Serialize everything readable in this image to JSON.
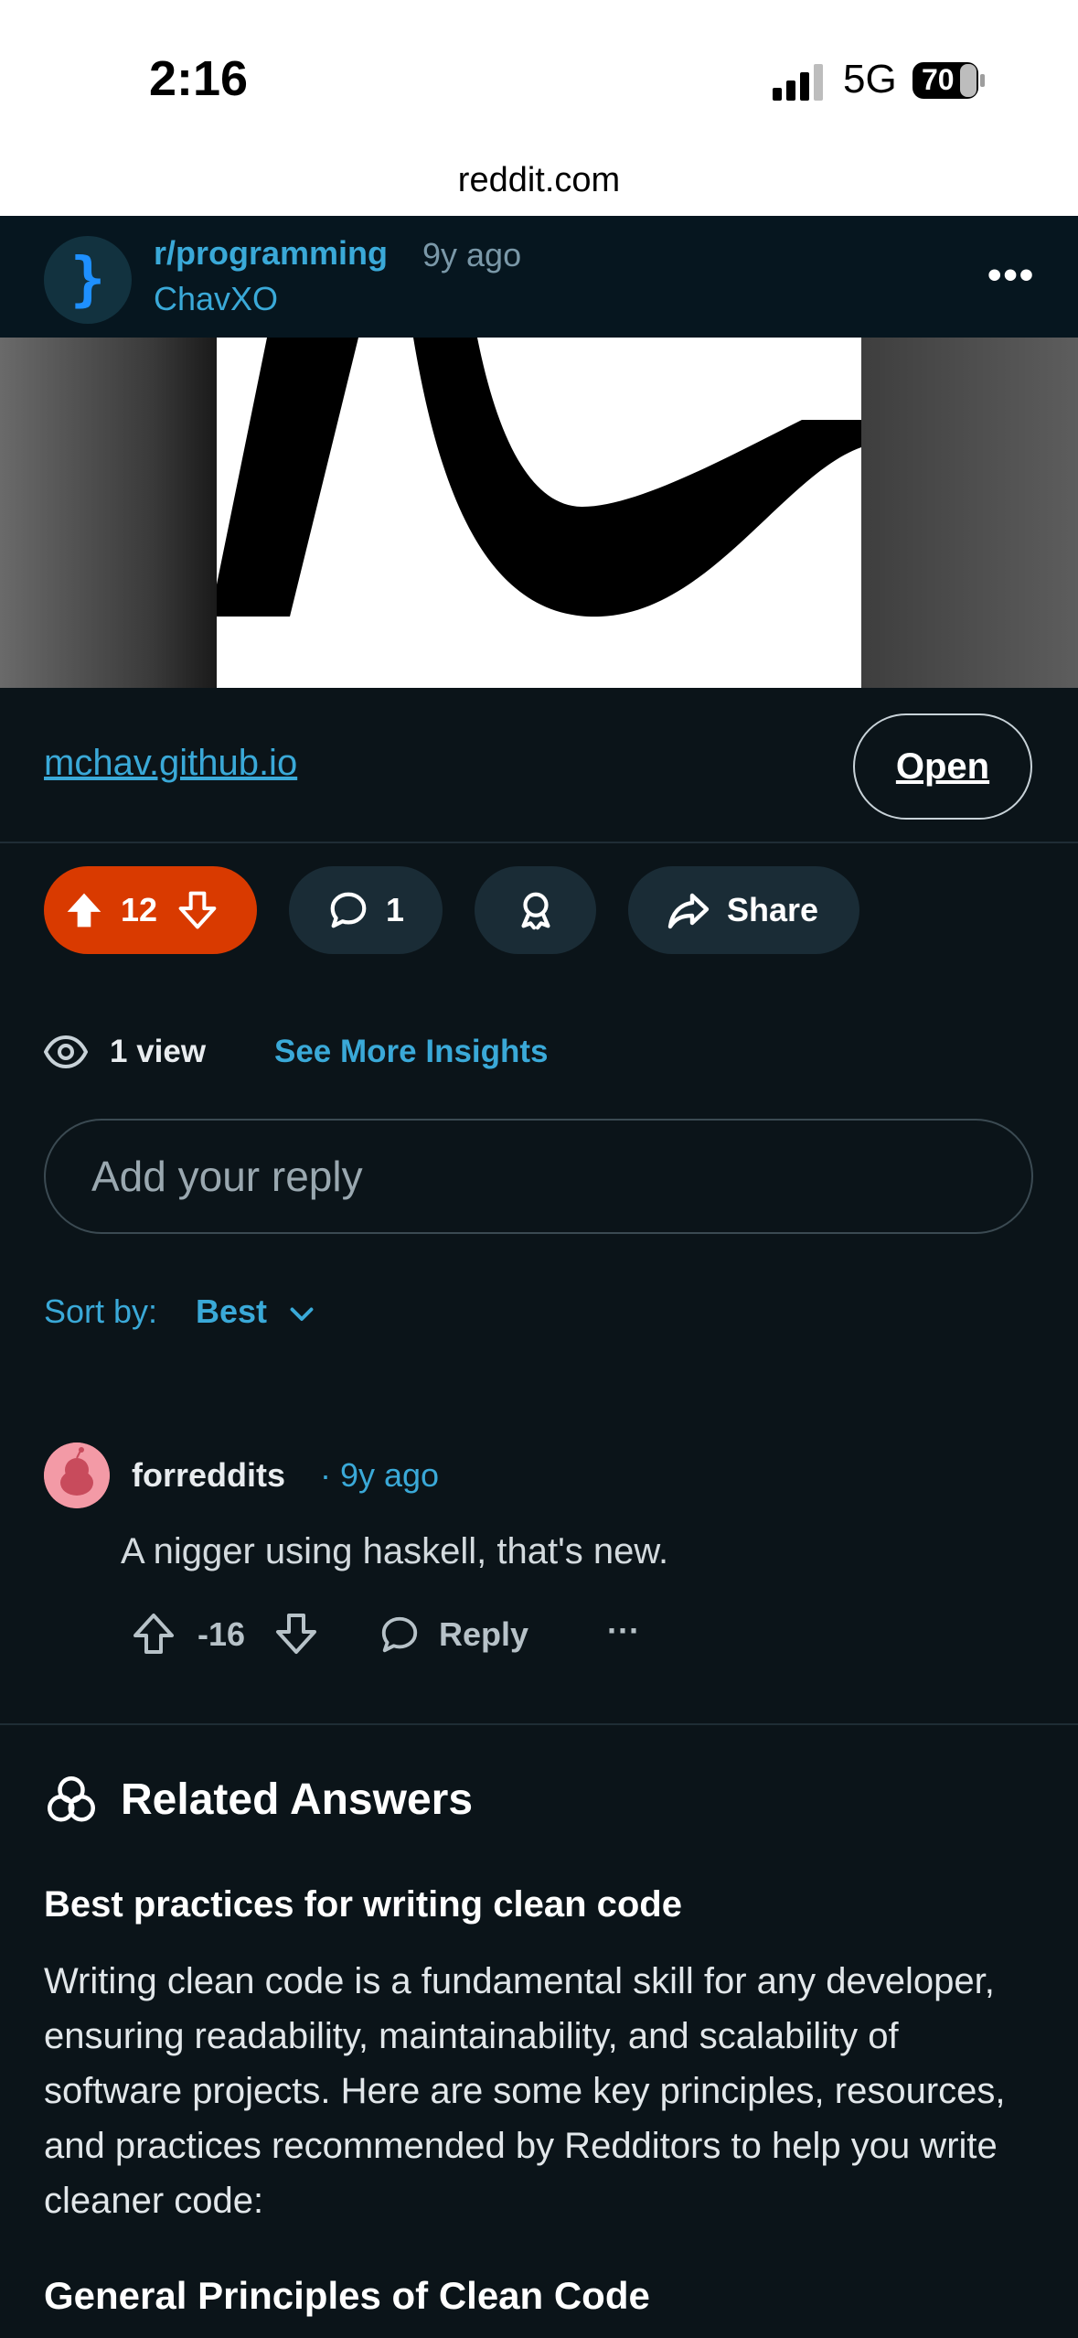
{
  "status_bar": {
    "time": "2:16",
    "network": "5G",
    "battery": "70"
  },
  "browser": {
    "url": "reddit.com"
  },
  "post": {
    "subreddit": "r/programming",
    "age": "9y ago",
    "author": "ChavXO",
    "subreddit_icon_glyph": "}",
    "link_domain": "mchav.github.io",
    "open_label": "Open",
    "score": "12",
    "comment_count": "1",
    "share_label": "Share",
    "views": "1 view",
    "insights_label": "See More Insights"
  },
  "reply": {
    "placeholder": "Add your reply"
  },
  "sort": {
    "label": "Sort by:",
    "value": "Best"
  },
  "comment": {
    "author": "forreddits",
    "age": "· 9y ago",
    "body": "A nigger using haskell, that's new.",
    "score": "-16",
    "reply_label": "Reply",
    "more_label": "···"
  },
  "related": {
    "title": "Related Answers",
    "question": "Best practices for writing clean code",
    "body": "Writing clean code is a fundamental skill for any developer, ensuring readability, maintainability, and scalability of software projects. Here are some key principles, resources, and practices recommended by Redditors to help you write cleaner code:",
    "subheading": "General Principles of Clean Code"
  },
  "colors": {
    "background": "#0b1419",
    "accent": "#3aa9d8",
    "upvote": "#d93a00"
  }
}
